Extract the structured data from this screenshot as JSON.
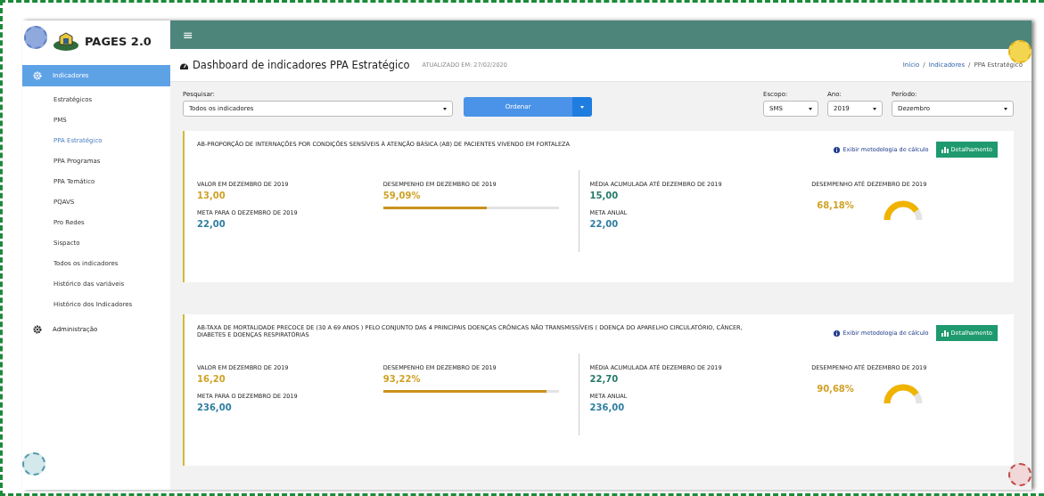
{
  "app": {
    "name": "PAGES 2.0",
    "menu_icon": "≡"
  },
  "sidebar": {
    "items": [
      {
        "label": "Indicadores",
        "selected": true,
        "children": [
          {
            "label": "Estratégicos",
            "selected": false
          },
          {
            "label": "PMS",
            "selected": false
          },
          {
            "label": "PPA Estratégico",
            "selected": true
          },
          {
            "label": "PPA Programas",
            "selected": false
          },
          {
            "label": "PPA Temático",
            "selected": false
          },
          {
            "label": "PQAVS",
            "selected": false
          },
          {
            "label": "Pro Redes",
            "selected": false
          },
          {
            "label": "Sispacto",
            "selected": false
          },
          {
            "label": "Todos os indicadores",
            "selected": false
          },
          {
            "label": "Histórico das variáveis",
            "selected": false
          },
          {
            "label": "Histórico dos Indicadores",
            "selected": false
          }
        ]
      },
      {
        "label": "Administração",
        "selected": false
      }
    ]
  },
  "header": {
    "title": "Dashboard de indicadores PPA Estratégico",
    "updated": "ATUALIZADO EM: 27/02/2020",
    "breadcrumb": [
      "Início",
      "Indicadores",
      "PPA Estratégico"
    ],
    "separator": "/"
  },
  "filters": {
    "search_label": "Pesquisar:",
    "search_value": "Todos os indicadores",
    "order_button": "Ordenar",
    "selects": [
      {
        "label": "Escopo:",
        "value": "SMS"
      },
      {
        "label": "Ano:",
        "value": "2019"
      },
      {
        "label": "Período:",
        "value": "Dezembro"
      }
    ]
  },
  "cards": [
    {
      "title": "AB-PROPORÇÃO DE INTERNAÇÕES POR CONDIÇÕES SENSÍVEIS À ATENÇÃO BÁSICA (AB) DE PACIENTES VIVENDO EM FORTALEZA",
      "method_link": "Exibir metodologia de cálculo",
      "detail_button": "Detalhamento",
      "value_label": "VALOR EM DEZEMBRO DE 2019",
      "value": "13,00",
      "goal_label": "META PARA O DEZEMBRO DE 2019",
      "goal": "22,00",
      "perf_label": "DESEMPENHO EM DEZEMBRO DE 2019",
      "perf": "59,09%",
      "level": 0.5909,
      "avg_label": "MÉDIA ACUMULADA ATÉ DEZEMBRO DE 2019",
      "avg": "15,00",
      "annual_label": "META ANUAL",
      "annual": "22,00",
      "cum_label": "DESEMPENHO ATÉ DEZEMBRO DE 2019",
      "cum": "68,18%"
    },
    {
      "title": "AB-TAXA DE MORTALIDADE PRECOCE DE (30 A 69 ANOS ) PELO CONJUNTO DAS 4 PRINCIPAIS DOENÇAS CRÔNICAS NÃO TRANSMISSÍVEIS ( DOENÇA DO APARELHO CIRCULATÓRIO, CÂNCER, DIABETES E DOENÇAS RESPIRATÓRIAS",
      "method_link": "Exibir metodologia de cálculo",
      "detail_button": "Detalhamento",
      "value_label": "VALOR EM DEZEMBRO DE 2019",
      "value": "16,20",
      "goal_label": "META PARA O DEZEMBRO DE 2019",
      "goal": "236,00",
      "perf_label": "DESEMPENHO EM DEZEMBRO DE 2019",
      "perf": "93,22%",
      "level": 0.9322,
      "avg_label": "MÉDIA ACUMULADA ATÉ DEZEMBRO DE 2019",
      "avg": "22,70",
      "annual_label": "META ANUAL",
      "annual": "236,00",
      "cum_label": "DESEMPENHO ATÉ DEZEMBRO DE 2019",
      "cum": "90,68%"
    }
  ]
}
